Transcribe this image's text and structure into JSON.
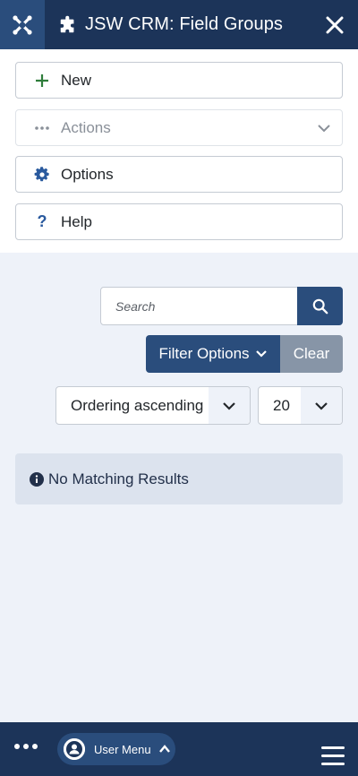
{
  "header": {
    "title": "JSW CRM: Field Groups",
    "logo_icon": "joomla-logo-icon",
    "title_icon": "puzzle-icon",
    "close_icon": "close-icon"
  },
  "toolbar": {
    "new_label": "New",
    "actions_label": "Actions",
    "options_label": "Options",
    "help_label": "Help"
  },
  "search": {
    "placeholder": "Search"
  },
  "filters": {
    "filter_options_label": "Filter Options",
    "clear_label": "Clear",
    "ordering_value": "Ordering ascending",
    "limit_value": "20"
  },
  "alert": {
    "message": "No Matching Results"
  },
  "bottombar": {
    "user_menu_label": "User Menu"
  },
  "colors": {
    "header_bg": "#1c3459",
    "accent": "#2a4d7c",
    "clear_bg": "#8795a7",
    "page_bg": "#eef2f9",
    "alert_bg": "#dce3ee"
  }
}
